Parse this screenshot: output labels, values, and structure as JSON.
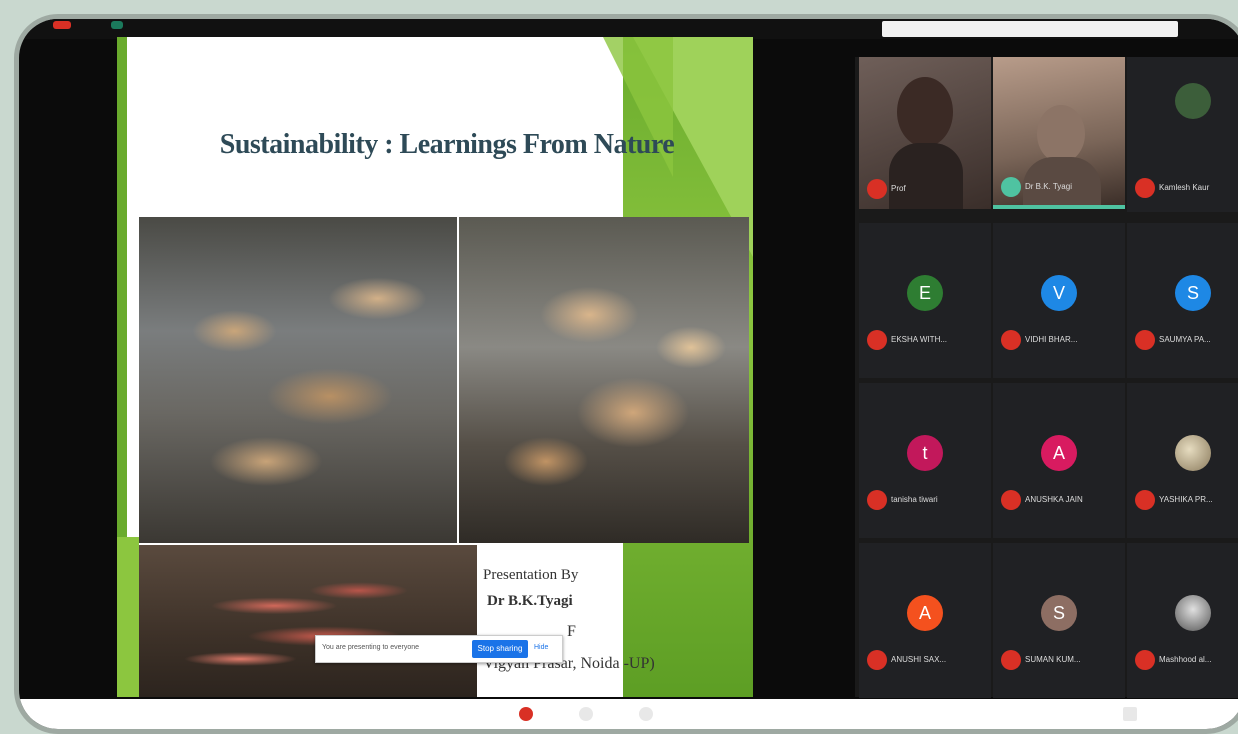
{
  "slide": {
    "title": "Sustainability : Learnings From Nature",
    "presentation_by": "Presentation By",
    "presenter": "Dr B.K.Tyagi",
    "org_fragment": "F",
    "org": "Vigyan Prasar, Noida -UP)"
  },
  "share_bar": {
    "text": "You are presenting to everyone",
    "stop_label": "Stop sharing",
    "hide_label": "Hide"
  },
  "participants": [
    {
      "name": "Prof",
      "initial": "",
      "color": "#6f5f59",
      "type": "video"
    },
    {
      "name": "Dr B.K. Tyagi",
      "initial": "",
      "color": "#b89c8a",
      "type": "video"
    },
    {
      "name": "Kamlesh Kaur",
      "initial": "",
      "color": "#3c5e3a",
      "type": "photo"
    },
    {
      "name": "EKSHA WITH...",
      "initial": "E",
      "color": "#2e7d32",
      "type": "initial"
    },
    {
      "name": "VIDHI BHAR...",
      "initial": "V",
      "color": "#1e88e5",
      "type": "initial"
    },
    {
      "name": "SAUMYA PA...",
      "initial": "S",
      "color": "#1e88e5",
      "type": "initial"
    },
    {
      "name": "tanisha tiwari",
      "initial": "t",
      "color": "#c2185b",
      "type": "initial"
    },
    {
      "name": "ANUSHKA JAIN",
      "initial": "A",
      "color": "#d81b60",
      "type": "initial"
    },
    {
      "name": "YASHIKA PR...",
      "initial": "",
      "color": "#b6a37e",
      "type": "photo"
    },
    {
      "name": "ANUSHI SAX...",
      "initial": "A",
      "color": "#f4511e",
      "type": "initial"
    },
    {
      "name": "SUMAN KUM...",
      "initial": "S",
      "color": "#8d6e63",
      "type": "initial"
    },
    {
      "name": "Mashhood al...",
      "initial": "",
      "color": "#9e9e9e",
      "type": "photo"
    }
  ],
  "colors": {
    "slide_green": "#8cc63f",
    "title_color": "#2e4a57",
    "mic_off": "#d93025",
    "meet_blue": "#1a73e8"
  }
}
